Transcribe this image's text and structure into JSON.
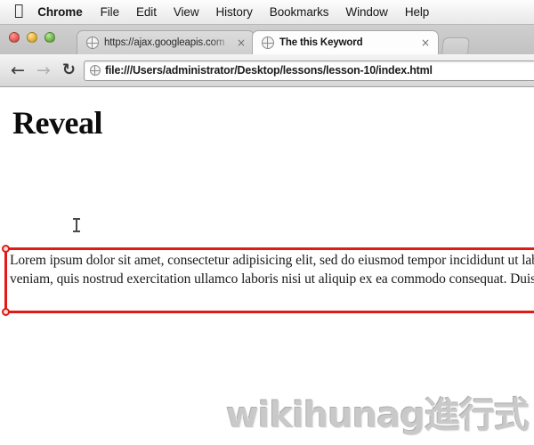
{
  "menubar": {
    "apple_icon": "apple-logo",
    "items": [
      {
        "label": "Chrome",
        "bold": true
      },
      {
        "label": "File"
      },
      {
        "label": "Edit"
      },
      {
        "label": "View"
      },
      {
        "label": "History"
      },
      {
        "label": "Bookmarks"
      },
      {
        "label": "Window"
      },
      {
        "label": "Help"
      }
    ]
  },
  "window_controls": {
    "close": "close-button",
    "minimize": "minimize-button",
    "maximize": "maximize-button"
  },
  "tabs": [
    {
      "title": "https://ajax.googleapis.com",
      "close_glyph": "×",
      "active": false
    },
    {
      "title": "The this Keyword",
      "close_glyph": "×",
      "active": true
    }
  ],
  "toolbar": {
    "back_glyph": "←",
    "forward_glyph": "→",
    "reload_glyph": "↻",
    "url": "file:///Users/administrator/Desktop/lessons/lesson-10/index.html"
  },
  "page": {
    "heading": "Reveal",
    "paragraph": "Lorem ipsum dolor sit amet, consectetur adipisicing elit, sed do eiusmod tempor incididunt ut labore et dolore magna aliqua. Ut enim ad minim veniam, quis nostrud exercitation ullamco laboris nisi ut aliquip ex ea commodo consequat. Duis aute irure dolor in reprehenderit in voluptate velit esse cillum dolore eu fugiat nulla pariatur."
  },
  "selection_overlay": {
    "color": "#e01b16",
    "handles": [
      "top-left",
      "bottom-left"
    ]
  },
  "watermark": {
    "text": "wikihunag進行式"
  }
}
